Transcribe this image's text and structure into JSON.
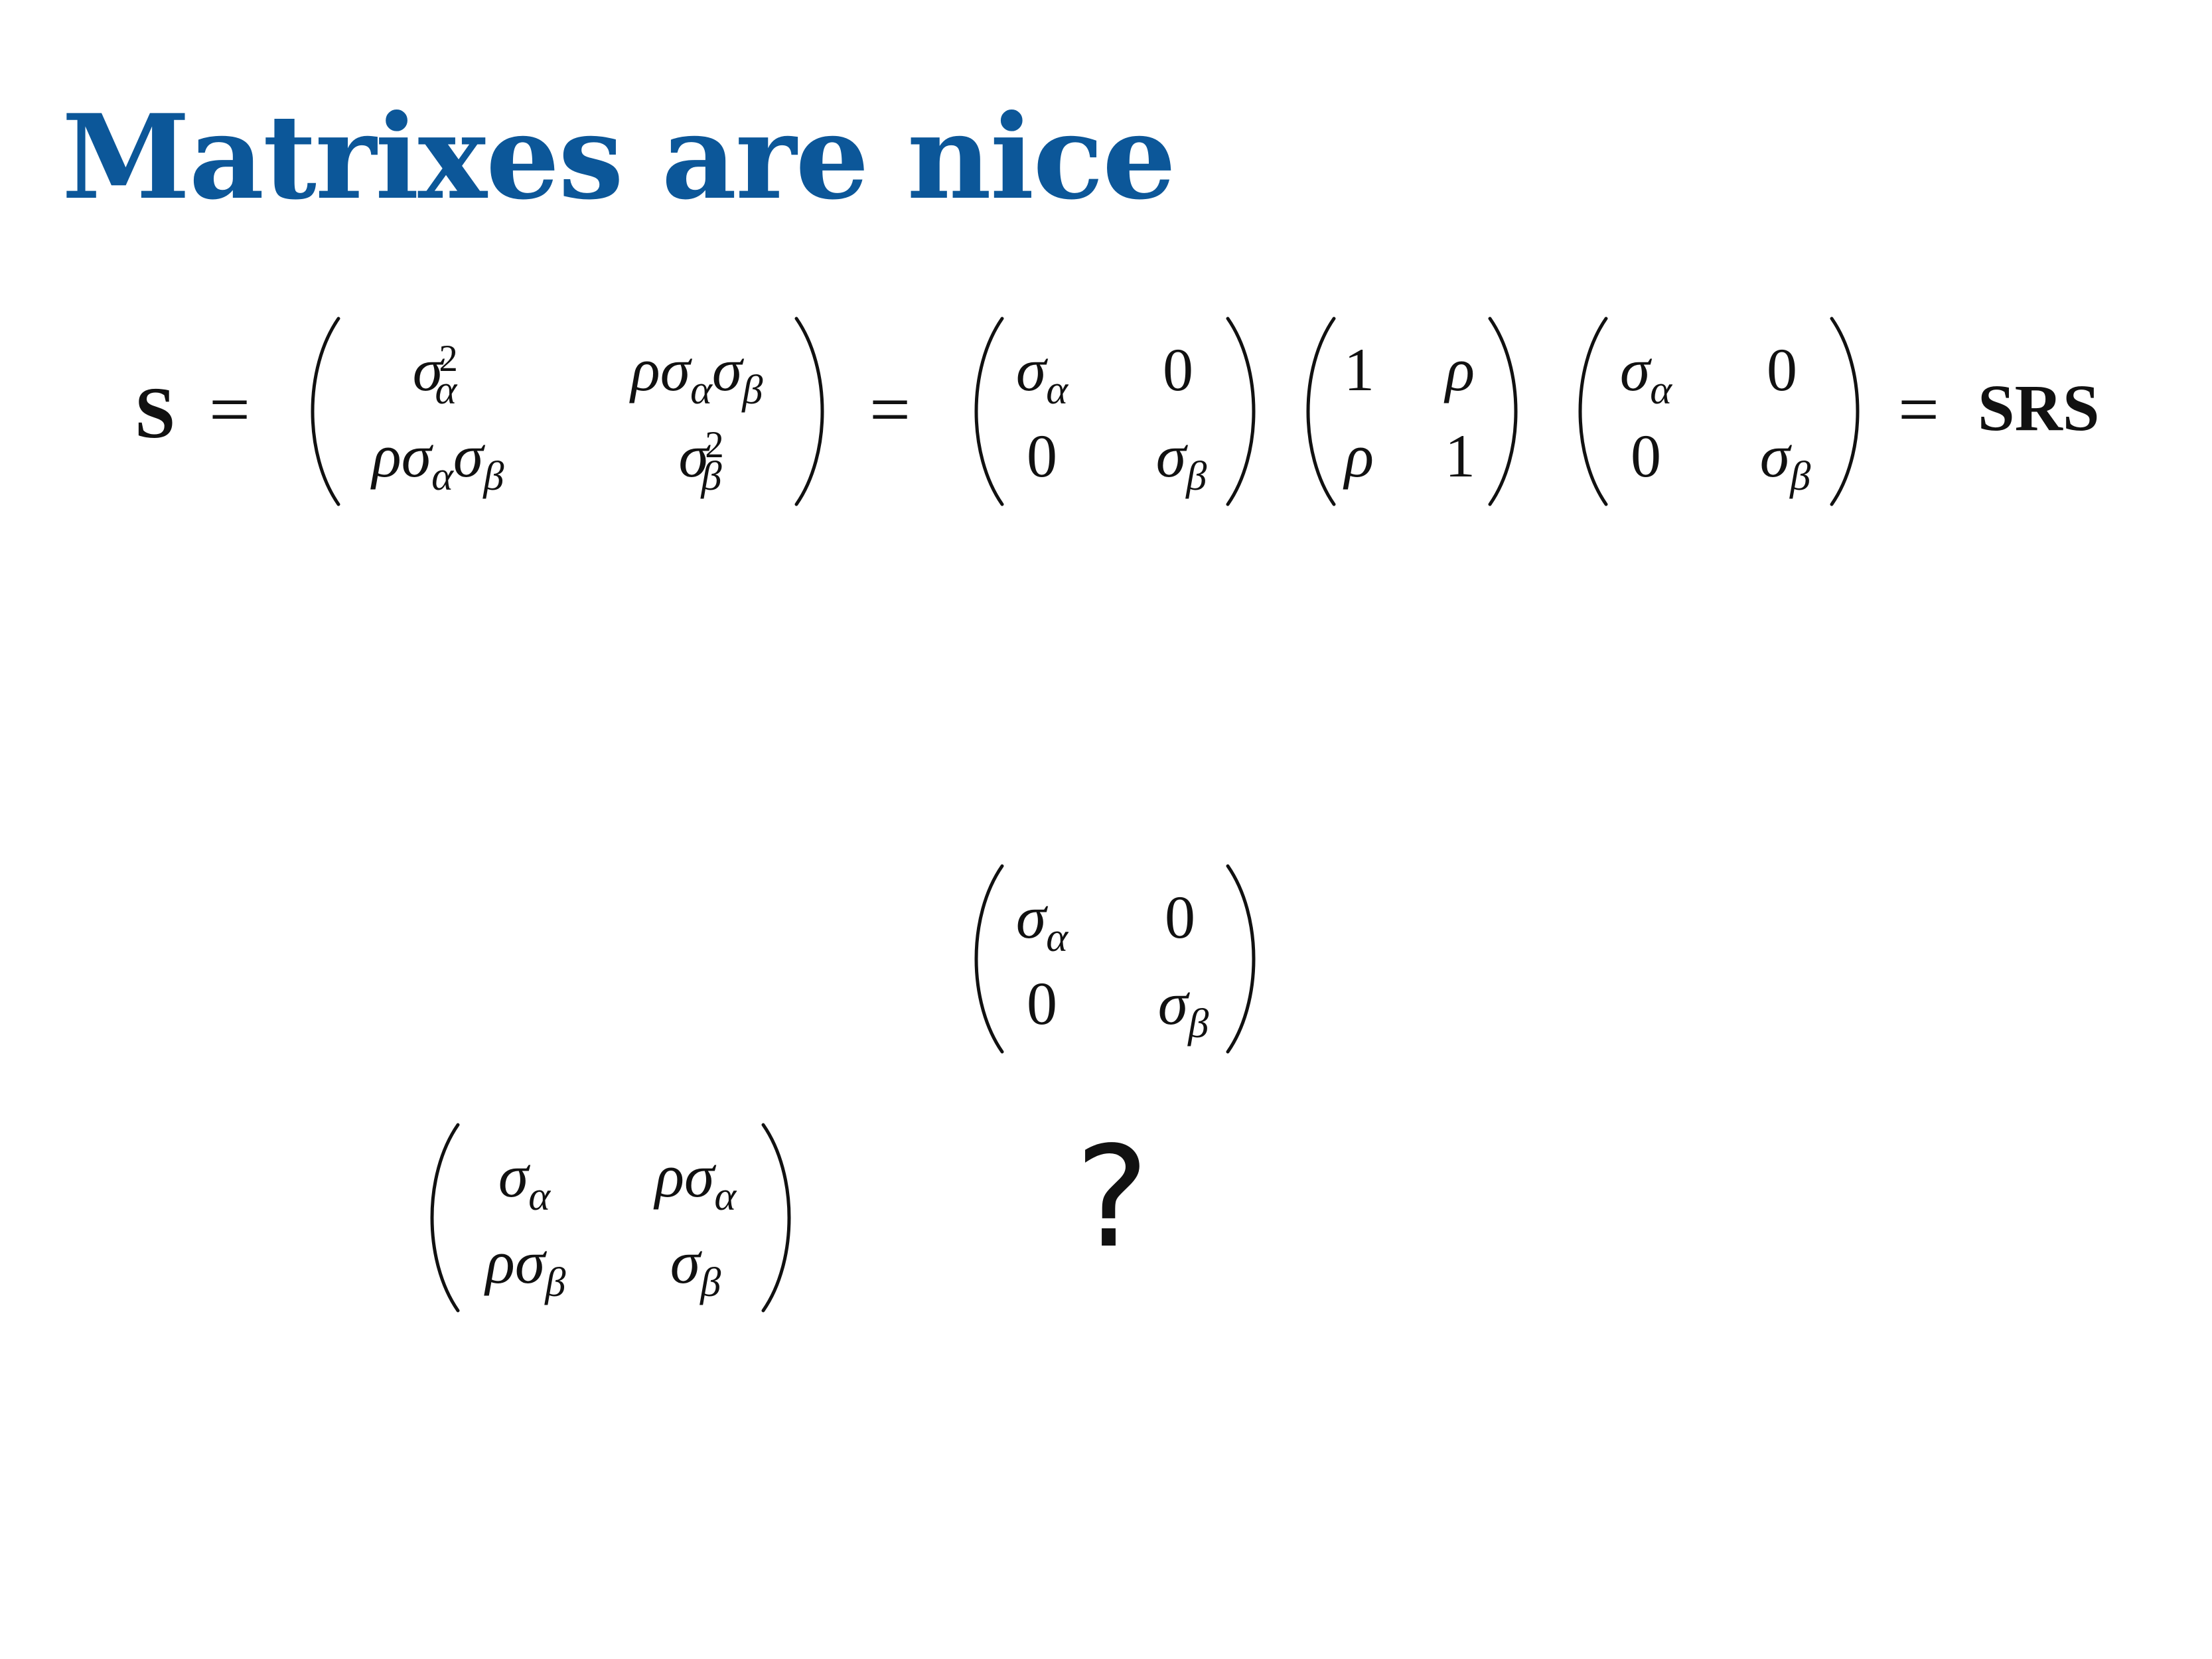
{
  "title": {
    "text": "Matrixes are nice",
    "color": "#0c5799"
  },
  "equation": {
    "lhs": "S",
    "equals_sign": "=",
    "rhs": "SRS",
    "covariance_matrix": {
      "r1c1": "σ",
      "r1c1_sup": "2",
      "r1c1_sub": "α",
      "r1c2": "ρσ",
      "r1c2_sub1": "α",
      "r1c2_mid": "σ",
      "r1c2_sub2": "β",
      "r2c1": "ρσ",
      "r2c1_sub1": "α",
      "r2c1_mid": "σ",
      "r2c1_sub2": "β",
      "r2c2": "σ",
      "r2c2_sup": "2",
      "r2c2_sub": "β"
    },
    "scale_matrix_left": {
      "r1c1": "σ",
      "r1c1_sub": "α",
      "r1c2": "0",
      "r2c1": "0",
      "r2c2": "σ",
      "r2c2_sub": "β"
    },
    "correlation_matrix": {
      "r1c1": "1",
      "r1c2": "ρ",
      "r2c1": "ρ",
      "r2c2": "1"
    },
    "scale_matrix_right": {
      "r1c1": "σ",
      "r1c1_sub": "α",
      "r1c2": "0",
      "r2c1": "0",
      "r2c2": "σ",
      "r2c2_sub": "β"
    }
  },
  "diagonal_matrix": {
    "r1c1": "σ",
    "r1c1_sub": "α",
    "r1c2": "0",
    "r2c1": "0",
    "r2c2": "σ",
    "r2c2_sub": "β"
  },
  "mixed_matrix": {
    "r1c1": "σ",
    "r1c1_sub": "α",
    "r1c2": "ρσ",
    "r1c2_sub": "α",
    "r2c1": "ρσ",
    "r2c1_sub": "β",
    "r2c2": "σ",
    "r2c2_sub": "β"
  },
  "question_mark": "?"
}
